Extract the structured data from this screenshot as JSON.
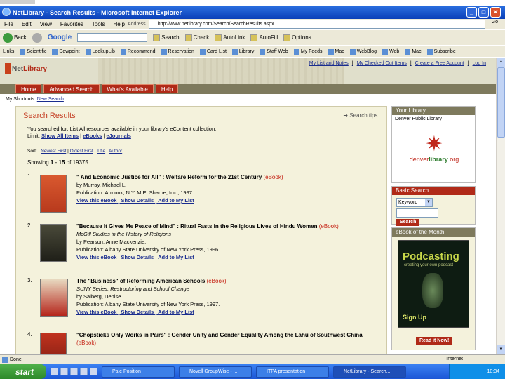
{
  "window": {
    "title": "NetLibrary - Search Results - Microsoft Internet Explorer",
    "min": "_",
    "max": "□",
    "close": "✕"
  },
  "menu": [
    "File",
    "Edit",
    "View",
    "Favorites",
    "Tools",
    "Help"
  ],
  "address": {
    "label": "Address",
    "url": "http://www.netlibrary.com/Search/SearchResults.aspx",
    "go": "Go"
  },
  "toolbar": {
    "back": "Back",
    "google": "Google",
    "items": [
      "Search",
      "Check",
      "AutoLink",
      "AutoFill",
      "Options"
    ]
  },
  "links": {
    "label": "Links",
    "items": [
      "Scientific",
      "Dewpoint",
      "LookupLib",
      "Recommend",
      "Reservation",
      "Card List",
      "Library",
      "Staff Web",
      "My Feeds",
      "Mac",
      "WebBlog",
      "Web",
      "Mac",
      "Subscribe"
    ]
  },
  "site": {
    "logo_pre": "Net",
    "logo_main": "Library",
    "toplinks": [
      "My List and Notes",
      "My Checked Out Items",
      "Create a Free Account",
      "Log In"
    ],
    "tabs": [
      "Home",
      "Advanced Search",
      "What's Available",
      "Help"
    ],
    "shortcuts_label": "My Shortcuts:",
    "shortcuts_link": "New Search"
  },
  "results": {
    "title": "Search Results",
    "help": "Search tips...",
    "searched_line": "You searched for: List All resources available in your library's eContent collection.",
    "limit_label": "Limit:",
    "limit_all": "Show All Items",
    "limit_ebooks": "eBooks",
    "limit_ejournals": "eJournals",
    "sort_label": "Sort:",
    "sort_options": [
      "Newest First",
      "Oldest First",
      "Title",
      "Author"
    ],
    "showing_prefix": "Showing",
    "showing_from": "1",
    "showing_dash": "-",
    "showing_to": "15",
    "showing_of": "of",
    "showing_total": "19375",
    "items": [
      {
        "num": "1.",
        "title": "\" And Economic Justice for All\" : Welfare Reform for the 21st Century",
        "type": "(eBook)",
        "series": "",
        "author": "by Murray, Michael L.",
        "pub": "Publication: Armonk, N.Y. M.E. Sharpe, Inc., 1997.",
        "view": "View this eBook",
        "details": "Show Details",
        "add": "Add to My List"
      },
      {
        "num": "2.",
        "title": "\"Because It Gives Me Peace of Mind\" : Ritual Fasts in the Religious Lives of Hindu Women",
        "type": "(eBook)",
        "series": "McGill Studies in the History of Religions",
        "author": "by Pearson, Anne Mackenzie.",
        "pub": "Publication: Albany State University of New York Press, 1996.",
        "view": "View this eBook",
        "details": "Show Details",
        "add": "Add to My List"
      },
      {
        "num": "3.",
        "title": "The \"Business\" of Reforming American Schools",
        "type": "(eBook)",
        "series": "SUNY Series, Restructuring and School Change",
        "author": "by Salberg, Denise.",
        "pub": "Publication: Albany State University of New York Press, 1997.",
        "view": "View this eBook",
        "details": "Show Details",
        "add": "Add to My List"
      },
      {
        "num": "4.",
        "title": "\"Chopsticks Only Works in Pairs\" : Gender Unity and Gender Equality Among the Lahu of Southwest China",
        "type": "(eBook)",
        "series": "",
        "author": "",
        "pub": "",
        "view": "",
        "details": "",
        "add": ""
      }
    ]
  },
  "sidebar": {
    "library_hd": "Your Library",
    "library_sub": "Denver Public Library",
    "library_name_a": "denver",
    "library_name_b": "library",
    "library_name_c": ".org",
    "basic_hd": "Basic Search",
    "basic_select": "Keyword",
    "basic_btn": "Search",
    "botm_hd": "eBook of the Month",
    "botm_title": "Podcasting",
    "botm_sub": "creating your own podcast",
    "botm_sign": "Sign Up",
    "botm_btn": "Read it Now!"
  },
  "status": {
    "text": "Done",
    "zone": "Internet"
  },
  "taskbar": {
    "start": "start",
    "tasks": [
      "Pale Position",
      "Novell GroupWise - ...",
      "ITPA presentation",
      "NetLibrary - Search..."
    ],
    "time": "10:34"
  }
}
